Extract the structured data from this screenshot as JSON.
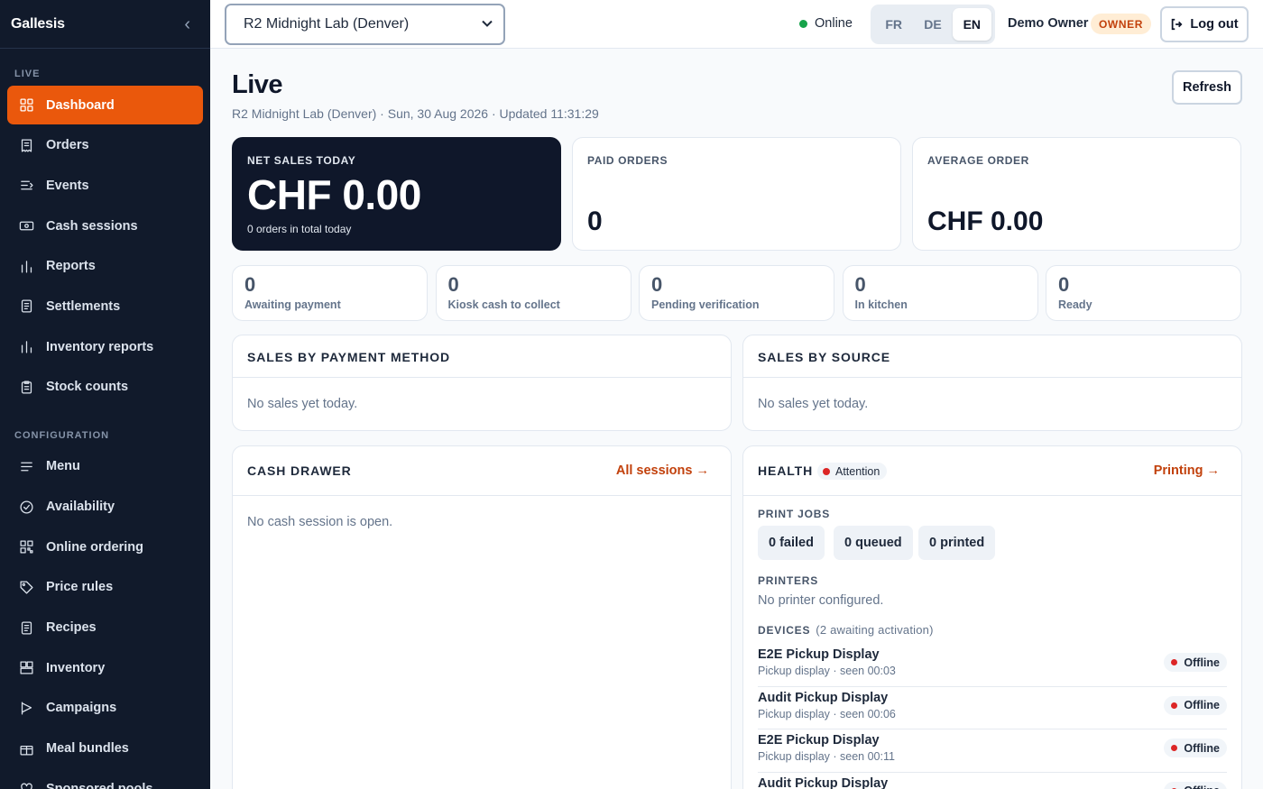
{
  "app": {
    "name": "Gallesis",
    "collapse_glyph": "‹"
  },
  "sidebar": {
    "live_label": "LIVE",
    "config_label": "CONFIGURATION",
    "live_items": [
      {
        "label": "Dashboard",
        "icon": "grid-icon"
      },
      {
        "label": "Orders",
        "icon": "receipt-icon"
      },
      {
        "label": "Events",
        "icon": "events-icon"
      },
      {
        "label": "Cash sessions",
        "icon": "cash-icon"
      },
      {
        "label": "Reports",
        "icon": "bar-chart-icon"
      },
      {
        "label": "Settlements",
        "icon": "document-icon"
      },
      {
        "label": "Inventory reports",
        "icon": "bar-chart-icon"
      },
      {
        "label": "Stock counts",
        "icon": "clipboard-icon"
      }
    ],
    "config_items": [
      {
        "label": "Menu",
        "icon": "menu-icon"
      },
      {
        "label": "Availability",
        "icon": "check-circle-icon"
      },
      {
        "label": "Online ordering",
        "icon": "qr-icon"
      },
      {
        "label": "Price rules",
        "icon": "tag-icon"
      },
      {
        "label": "Recipes",
        "icon": "document-icon"
      },
      {
        "label": "Inventory",
        "icon": "boxes-icon"
      },
      {
        "label": "Campaigns",
        "icon": "flag-icon"
      },
      {
        "label": "Meal bundles",
        "icon": "gift-icon"
      },
      {
        "label": "Sponsored pools",
        "icon": "heart-icon"
      }
    ],
    "active": "Dashboard"
  },
  "topbar": {
    "location": "R2 Midnight Lab (Denver)",
    "status": "Online",
    "languages": [
      "FR",
      "DE",
      "EN"
    ],
    "active_language": "EN",
    "user": "Demo Owner",
    "role": "OWNER",
    "logout": "Log out"
  },
  "page": {
    "title": "Live",
    "subtitle": "R2 Midnight Lab (Denver) · Sun, 30 Aug 2026 · Updated 11:31:29",
    "refresh": "Refresh"
  },
  "kpis": {
    "net_sales_label": "NET SALES TODAY",
    "net_sales_value": "CHF 0.00",
    "net_sales_note": "0 orders in total today",
    "paid_orders_label": "PAID ORDERS",
    "paid_orders_value": "0",
    "avg_order_label": "AVERAGE ORDER",
    "avg_order_value": "CHF 0.00"
  },
  "stats": [
    {
      "value": "0",
      "label": "Awaiting payment"
    },
    {
      "value": "0",
      "label": "Kiosk cash to collect"
    },
    {
      "value": "0",
      "label": "Pending verification"
    },
    {
      "value": "0",
      "label": "In kitchen"
    },
    {
      "value": "0",
      "label": "Ready"
    }
  ],
  "sales_by_payment": {
    "title": "SALES BY PAYMENT METHOD",
    "empty": "No sales yet today."
  },
  "sales_by_source": {
    "title": "SALES BY SOURCE",
    "empty": "No sales yet today."
  },
  "cash_drawer": {
    "title": "CASH DRAWER",
    "link": "All sessions →",
    "empty": "No cash session is open."
  },
  "health": {
    "title": "HEALTH",
    "status": "Attention",
    "link": "Printing →",
    "print_jobs_label": "PRINT JOBS",
    "print_jobs": [
      "0  failed",
      "0  queued",
      "0  printed"
    ],
    "printers_label": "PRINTERS",
    "printers_empty": "No printer configured.",
    "devices_label": "DEVICES",
    "devices_note": "(2 awaiting activation)",
    "devices": [
      {
        "name": "E2E Pickup Display",
        "detail": "Pickup display · seen 00:03",
        "status": "Offline"
      },
      {
        "name": "Audit Pickup Display",
        "detail": "Pickup display · seen 00:06",
        "status": "Offline"
      },
      {
        "name": "E2E Pickup Display",
        "detail": "Pickup display · seen 00:11",
        "status": "Offline"
      },
      {
        "name": "Audit Pickup Display",
        "detail": "",
        "status": "Offline"
      }
    ]
  },
  "colors": {
    "accent": "#ea580c",
    "sidebar_bg": "#111a2b",
    "online": "#16a34a",
    "alert": "#dc2626"
  }
}
